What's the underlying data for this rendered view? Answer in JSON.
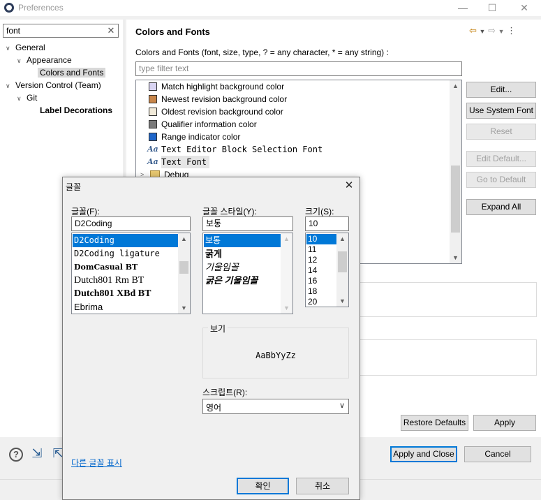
{
  "window": {
    "title": "Preferences"
  },
  "sidebar": {
    "search_value": "font",
    "tree": [
      {
        "label": "General",
        "level": 0,
        "expanded": true
      },
      {
        "label": "Appearance",
        "level": 1,
        "expanded": true
      },
      {
        "label": "Colors and Fonts",
        "level": 2,
        "selected": true
      },
      {
        "label": "Version Control (Team)",
        "level": 0,
        "expanded": true
      },
      {
        "label": "Git",
        "level": 1,
        "expanded": true
      },
      {
        "label": "Label Decorations",
        "level": 2
      }
    ]
  },
  "page": {
    "title": "Colors and Fonts",
    "description": "Colors and Fonts (font, size, type, ? = any character, * = any string) :",
    "filter_placeholder": "type filter text",
    "items": [
      {
        "label": "Match highlight background color",
        "kind": "color",
        "color": "#d9d4f2"
      },
      {
        "label": "Newest revision background color",
        "kind": "color",
        "color": "#c8864a"
      },
      {
        "label": "Oldest revision background color",
        "kind": "color",
        "color": "#f1ead9"
      },
      {
        "label": "Qualifier information color",
        "kind": "color",
        "color": "#7a7a7a"
      },
      {
        "label": "Range indicator color",
        "kind": "color",
        "color": "#1e66c9"
      },
      {
        "label": "Text Editor Block Selection Font",
        "kind": "font"
      },
      {
        "label": "Text Font",
        "kind": "font",
        "selected": true
      },
      {
        "label": "Debug",
        "kind": "folder"
      }
    ],
    "font_glyph": "Aa",
    "buttons": {
      "edit": "Edit...",
      "use_system_font": "Use System Font",
      "reset": "Reset",
      "edit_default": "Edit Default...",
      "go_to_default": "Go to Default",
      "expand_all": "Expand All",
      "restore_defaults": "Restore Defaults",
      "apply": "Apply",
      "apply_and_close": "Apply and Close",
      "cancel": "Cancel"
    }
  },
  "font_dialog": {
    "title": "글꼴",
    "font_label": "글꼴(F):",
    "font_value": "D2Coding",
    "fonts": [
      "D2Coding",
      "D2Coding ligature",
      "DomCasual BT",
      "Dutch801 Rm BT",
      "Dutch801 XBd BT",
      "Ebrima"
    ],
    "style_label": "글꼴 스타일(Y):",
    "style_value": "보통",
    "styles": [
      "보통",
      "굵게",
      "기울임꼴",
      "굵은 기울임꼴"
    ],
    "size_label": "크기(S):",
    "size_value": "10",
    "sizes": [
      "10",
      "11",
      "12",
      "14",
      "16",
      "18",
      "20"
    ],
    "preview_label": "보기",
    "preview_text": "AaBbYyZz",
    "script_label": "스크립트(R):",
    "script_value": "영어",
    "more_fonts_link": "다른 글꼴 표시",
    "ok": "확인",
    "cancel": "취소"
  }
}
